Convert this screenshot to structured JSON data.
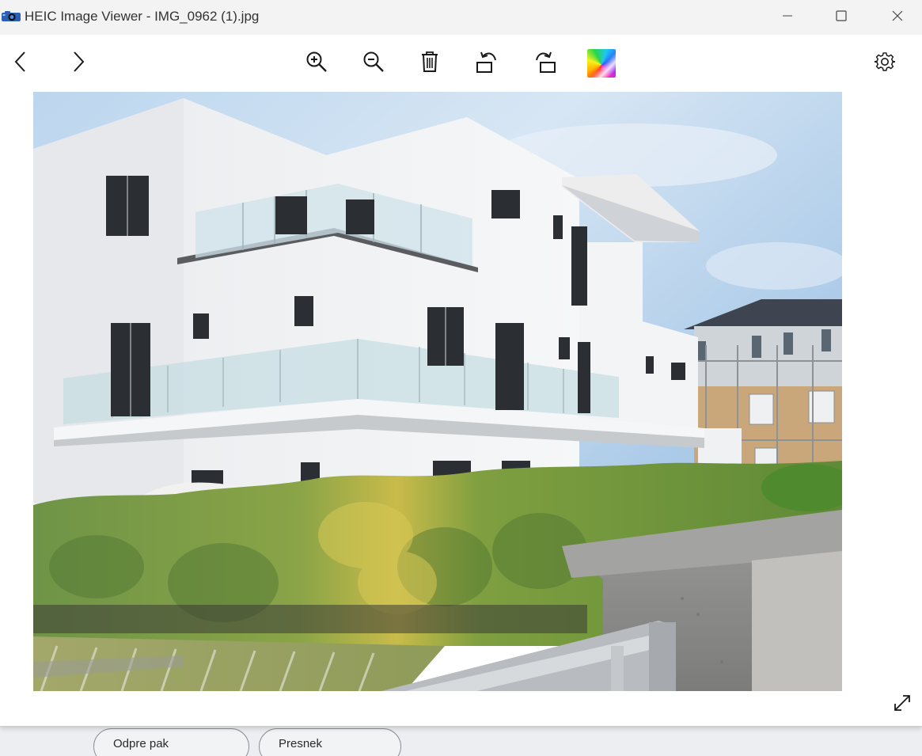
{
  "window": {
    "title": "HEIC Image Viewer - IMG_0962 (1).jpg",
    "app_icon": "camera-icon"
  },
  "title_controls": {
    "minimize_icon": "minimize-icon",
    "maximize_icon": "maximize-icon",
    "close_icon": "close-icon"
  },
  "toolbar": {
    "previous_icon": "chevron-left-icon",
    "next_icon": "chevron-right-icon",
    "zoom_in_icon": "zoom-in-icon",
    "zoom_out_icon": "zoom-out-icon",
    "delete_icon": "trash-icon",
    "rotate_left_icon": "rotate-left-icon",
    "rotate_right_icon": "rotate-right-icon",
    "color_icon": "color-palette-icon",
    "settings_icon": "gear-icon"
  },
  "viewer": {
    "image_subject": "photo",
    "fullscreen_icon": "expand-diagonal-icon"
  },
  "background": {
    "chip_1_label": "Odpre pak",
    "chip_2_label": "Presnek"
  },
  "colors": {
    "titlebar": "#f3f3f3",
    "window": "#ffffff",
    "icon": "#1a1a1a"
  }
}
